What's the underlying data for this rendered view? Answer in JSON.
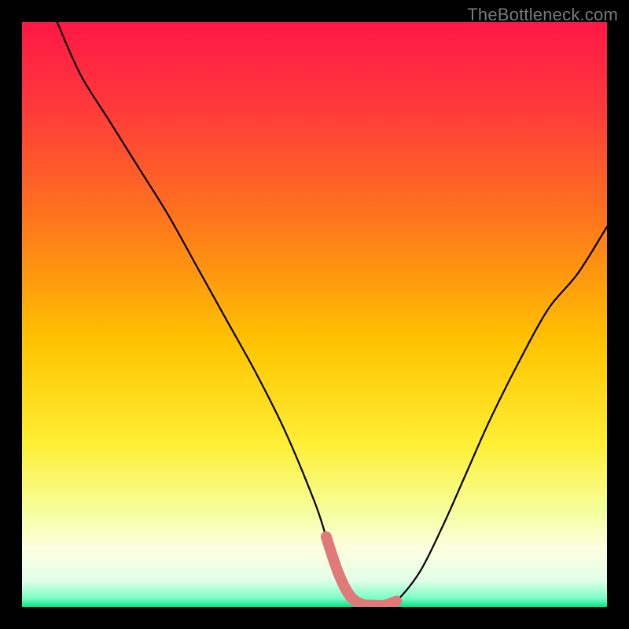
{
  "watermark": "TheBottleneck.com",
  "chart_data": {
    "type": "line",
    "title": "",
    "xlabel": "",
    "ylabel": "",
    "xlim": [
      0,
      100
    ],
    "ylim": [
      0,
      100
    ],
    "gradient_stops": [
      {
        "offset": 0.0,
        "color": "#ff1846"
      },
      {
        "offset": 0.15,
        "color": "#ff3a3a"
      },
      {
        "offset": 0.35,
        "color": "#ff7a1a"
      },
      {
        "offset": 0.55,
        "color": "#ffc400"
      },
      {
        "offset": 0.72,
        "color": "#ffef33"
      },
      {
        "offset": 0.84,
        "color": "#f6ffa0"
      },
      {
        "offset": 0.9,
        "color": "#fdffe0"
      },
      {
        "offset": 0.955,
        "color": "#e2ffe8"
      },
      {
        "offset": 0.985,
        "color": "#7affc7"
      },
      {
        "offset": 1.0,
        "color": "#00e582"
      }
    ],
    "series": [
      {
        "name": "bottleneck-curve",
        "color": "#000000",
        "x": [
          6,
          10,
          15,
          20,
          25,
          30,
          35,
          40,
          45,
          50,
          52,
          54,
          56,
          58,
          60,
          62,
          64,
          68,
          72,
          76,
          80,
          85,
          90,
          95,
          100
        ],
        "y": [
          100,
          91,
          83,
          75,
          67,
          58,
          49,
          40,
          30,
          18,
          12,
          6,
          2,
          0.5,
          0.3,
          0.3,
          1,
          6,
          14,
          23,
          32,
          42,
          51,
          57,
          65
        ]
      }
    ],
    "highlight": {
      "name": "sweet-spot",
      "color": "#e07a78",
      "x": [
        52,
        54,
        56,
        58,
        60,
        62,
        64
      ],
      "y": [
        12,
        6,
        2,
        0.5,
        0.3,
        0.3,
        1
      ]
    }
  }
}
